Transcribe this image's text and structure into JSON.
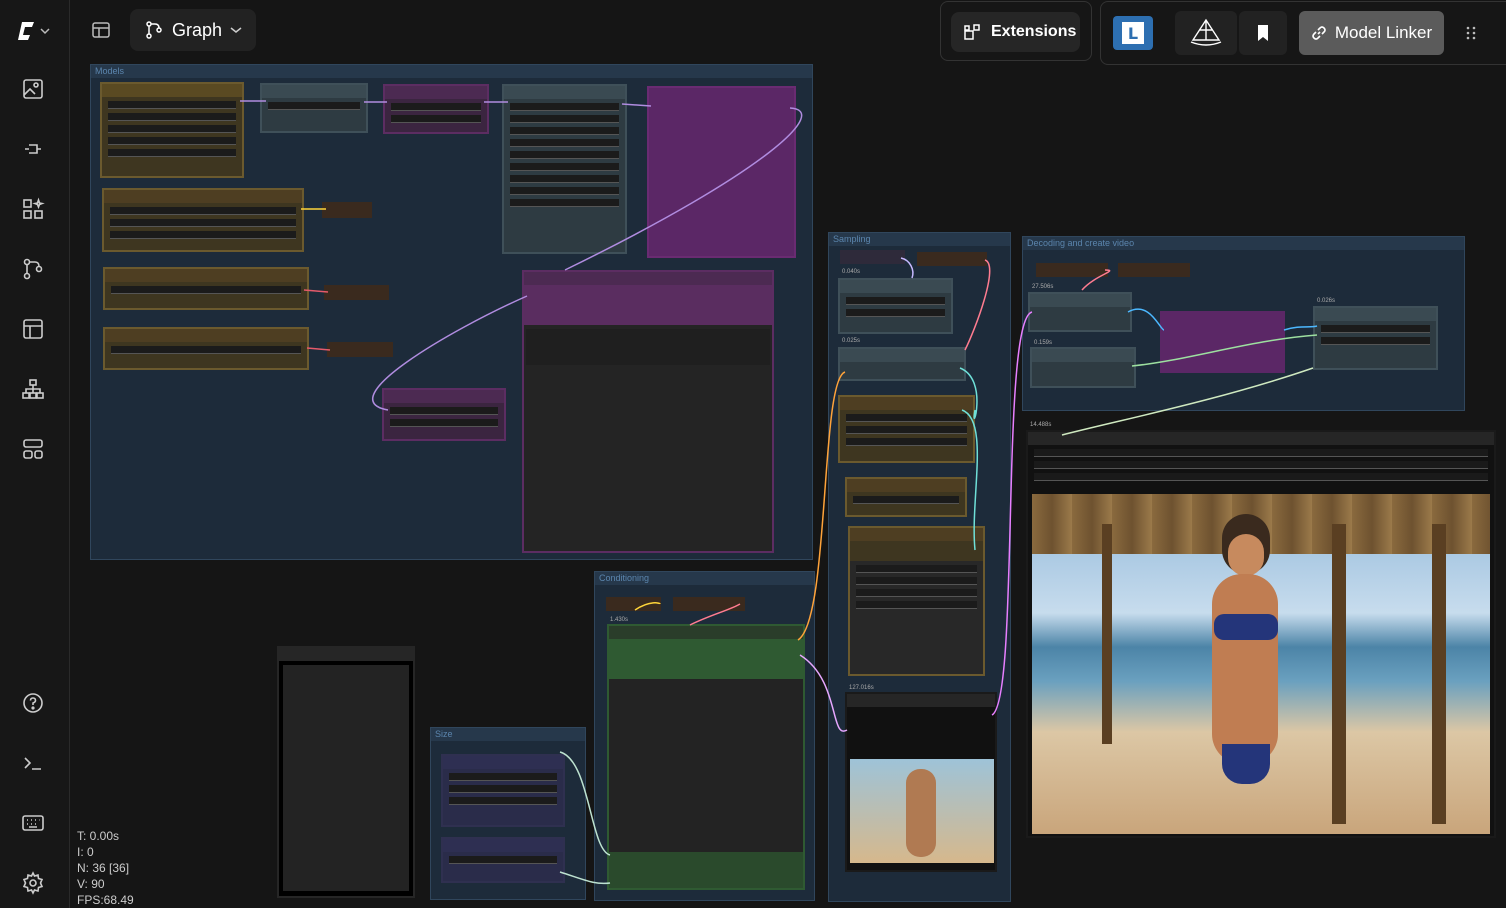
{
  "sidebar": {
    "items": [
      {
        "name": "images-icon"
      },
      {
        "name": "models-icon"
      },
      {
        "name": "node-library-icon"
      },
      {
        "name": "workflows-icon"
      },
      {
        "name": "templates-icon"
      },
      {
        "name": "queue-icon"
      },
      {
        "name": "layouts-icon"
      }
    ],
    "bottom": [
      {
        "name": "help-icon"
      },
      {
        "name": "terminal-icon"
      },
      {
        "name": "keyboard-icon"
      },
      {
        "name": "settings-icon"
      }
    ]
  },
  "toolbar": {
    "graph_label": "Graph",
    "extensions_label": "Extensions",
    "model_linker_label": "Model Linker"
  },
  "groups": {
    "models": "Models",
    "sampling": "Sampling",
    "decoding": "Decoding and create video",
    "conditioning": "Conditioning",
    "size": "Size"
  },
  "timings": {
    "t1": "0.040s",
    "t2": "0.025s",
    "t3": "27.506s",
    "t4": "0.159s",
    "t5": "0.026s",
    "t6": "14.488s",
    "t7": "1.430s",
    "t8": "127.016s"
  },
  "stats": {
    "t": "T: 0.00s",
    "i": "I: 0",
    "n": "N: 36 [36]",
    "v": "V: 90",
    "fps": "FPS:68.49"
  },
  "colors": {
    "group_bg": "#1d2b3a",
    "node_brown": "#6b5a2e",
    "node_purple": "#6a2b72",
    "node_slate": "#35464f",
    "node_green": "#2f5a32",
    "node_indigo": "#3b3c6b",
    "accent_linker": "#5b5b5b"
  }
}
